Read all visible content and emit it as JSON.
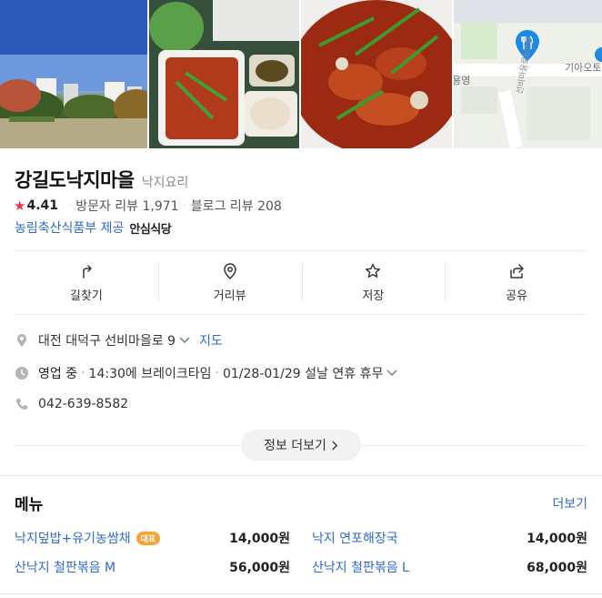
{
  "place": {
    "name": "강길도낙지마을",
    "category": "낙지요리",
    "rating": "4.41",
    "visitor_reviews": "방문자 리뷰 1,971",
    "blog_reviews": "블로그 리뷰 208",
    "cert_provider": "농림축산식품부 제공",
    "cert_badge": "안심식당"
  },
  "map_labels": {
    "left_label": "용영",
    "right_label": "기아오토",
    "street": "선비마을로6번길"
  },
  "actions": [
    {
      "label": "길찾기",
      "icon": "directions-icon"
    },
    {
      "label": "거리뷰",
      "icon": "location-pin-icon"
    },
    {
      "label": "저장",
      "icon": "star-outline-icon"
    },
    {
      "label": "공유",
      "icon": "share-icon"
    }
  ],
  "info": {
    "address": "대전 대덕구 선비마을로 9",
    "map_link": "지도",
    "status": "영업 중",
    "break_time": "14:30에 브레이크타임",
    "holiday": "01/28-01/29 설날 연휴 휴무",
    "phone": "042-639-8582",
    "more_info": "정보 더보기"
  },
  "menu": {
    "title": "메뉴",
    "more": "더보기",
    "items": [
      {
        "name": "낙지덮밥+유기농쌈채",
        "badge": "대표",
        "price": "14,000원"
      },
      {
        "name": "낙지 연포해장국",
        "price": "14,000원"
      },
      {
        "name": "산낙지 철판볶음 M",
        "price": "56,000원"
      },
      {
        "name": "산낙지 철판볶음 L",
        "price": "68,000원"
      }
    ]
  },
  "colors": {
    "link": "#2f6bc6",
    "star": "#e8344e",
    "badge": "#f7a33a",
    "map_pin": "#1e88e5"
  }
}
